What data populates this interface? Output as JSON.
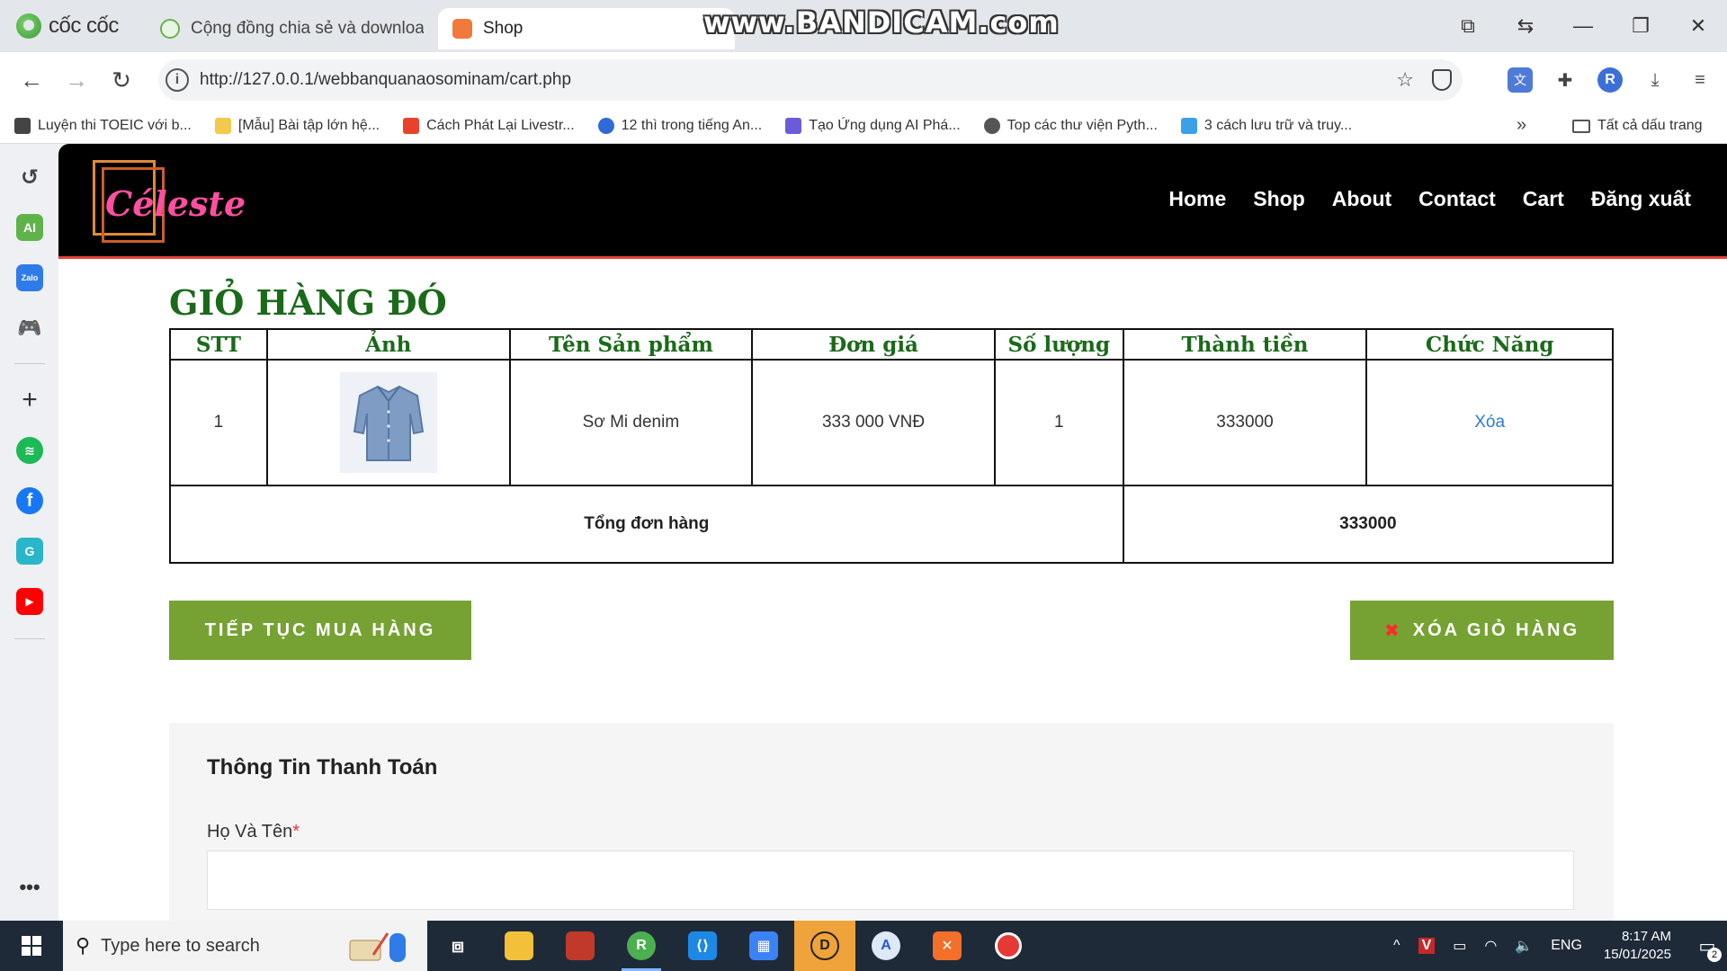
{
  "browser": {
    "brand_name": "cốc cốc",
    "watermark": "www.BANDICAM.com",
    "tabs": [
      {
        "label": "Cộng đồng chia sẻ và download s",
        "active": false
      },
      {
        "label": "Shop",
        "active": true
      }
    ],
    "url": "http://127.0.0.1/webbanquanaosominam/cart.php",
    "avatar_letter": "R",
    "bookmarks": [
      {
        "label": "Luyện thi TOEIC với b...",
        "color": "#444444"
      },
      {
        "label": "[Mẫu] Bài tập lớn hệ...",
        "color": "#f2c94c"
      },
      {
        "label": "Cách Phát Lại Livestr...",
        "color": "#e8432a"
      },
      {
        "label": "12 thì trong tiếng An...",
        "color": "#2f6ad9"
      },
      {
        "label": "Tạo Ứng dụng AI Phá...",
        "color": "#6a5cd8"
      },
      {
        "label": "Top các thư viện Pyth...",
        "color": "#555555"
      },
      {
        "label": "3 cách lưu trữ và truy...",
        "color": "#3aa0e8"
      }
    ],
    "all_bookmarks": "Tất cả dấu trang"
  },
  "sidebar": {
    "ai_label": "AI",
    "zalo_label": "Zalo",
    "g_label": "G"
  },
  "site": {
    "logo_text": "Céleste",
    "nav": [
      "Home",
      "Shop",
      "About",
      "Contact",
      "Cart",
      "Đăng xuất"
    ]
  },
  "cart": {
    "title": "GIỎ HÀNG ĐÓ",
    "headers": [
      "STT",
      "Ảnh",
      "Tên Sản phẩm",
      "Đơn giá",
      "Số lượng",
      "Thành tiền",
      "Chức Năng"
    ],
    "items": [
      {
        "stt": "1",
        "name": "Sơ Mi denim",
        "unit_price": "333 000 VNĐ",
        "qty": "1",
        "subtotal": "333000",
        "action": "Xóa"
      }
    ],
    "total_label": "Tổng đơn hàng",
    "total_value": "333000",
    "continue_button": "TIẾP TỤC MUA HÀNG",
    "clear_button": "XÓA GIỎ HÀNG"
  },
  "checkout": {
    "title": "Thông Tin Thanh Toán",
    "name_label": "Họ Và Tên",
    "required_mark": "*"
  },
  "taskbar": {
    "search_placeholder": "Type here to search",
    "language": "ENG",
    "time": "8:17 AM",
    "date": "15/01/2025",
    "notification_count": "2"
  }
}
